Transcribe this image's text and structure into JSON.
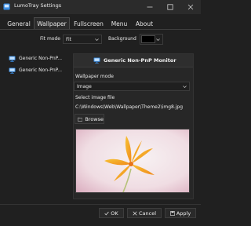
{
  "window": {
    "title": "LumoTray Settings",
    "controls": {
      "minimize": "minimize-icon",
      "maximize": "maximize-icon",
      "close": "close-icon"
    }
  },
  "tabs": [
    {
      "label": "General",
      "active": false
    },
    {
      "label": "Wallpaper",
      "active": true
    },
    {
      "label": "Fullscreen",
      "active": false
    },
    {
      "label": "Menu",
      "active": false
    },
    {
      "label": "About",
      "active": false
    }
  ],
  "toolbar": {
    "fit_mode_label": "Fit mode",
    "fit_mode_value": "Fit",
    "background_label": "Background",
    "background_color": "#000000"
  },
  "sidebar": {
    "items": [
      {
        "label": "Generic Non-PnP..."
      },
      {
        "label": "Generic Non-PnP..."
      }
    ]
  },
  "panel": {
    "header": "Generic Non-PnP Monitor",
    "wallpaper_mode_label": "Wallpaper mode",
    "wallpaper_mode_value": "Image",
    "select_image_label": "Select image file",
    "image_path": "C:\\Windows\\Web\\Wallpaper\\Theme2\\img8.jpg",
    "browse_label": "Browse"
  },
  "footer": {
    "ok_label": "OK",
    "cancel_label": "Cancel",
    "apply_label": "Apply"
  },
  "colors": {
    "window_bg": "#202020",
    "accent_icon": "#3a8ee6"
  }
}
